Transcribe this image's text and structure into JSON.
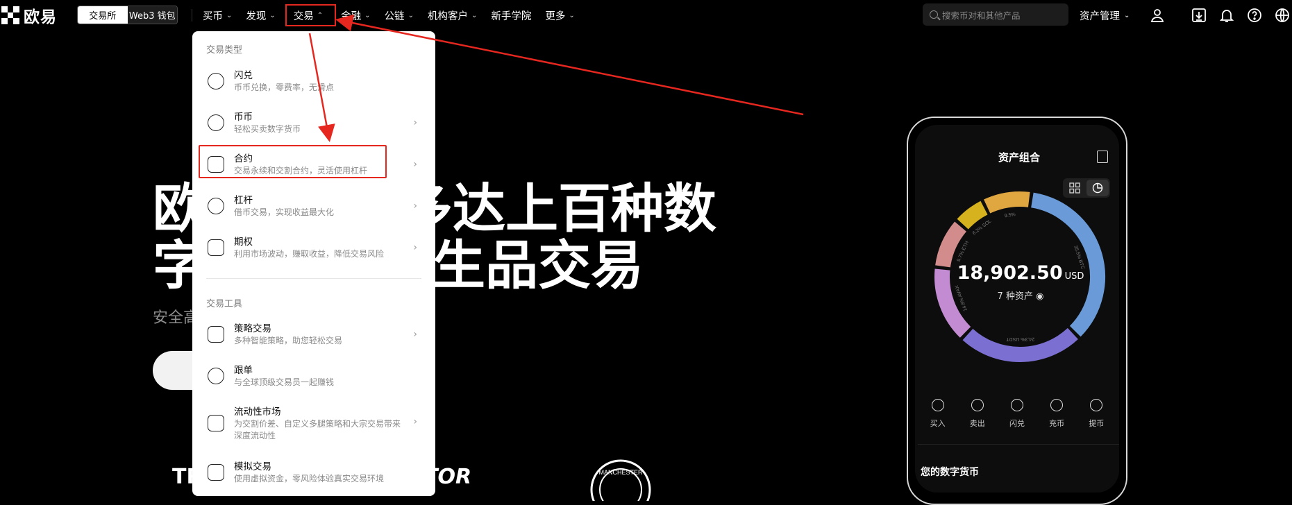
{
  "brand": {
    "name": "欧易"
  },
  "mode_switch": {
    "exchange": "交易所",
    "wallet": "Web3 钱包"
  },
  "nav": {
    "items": [
      {
        "label": "买币",
        "has_chevron": true
      },
      {
        "label": "发现",
        "has_chevron": true
      },
      {
        "label": "交易",
        "has_chevron": true,
        "expanded": true
      },
      {
        "label": "金融",
        "has_chevron": true
      },
      {
        "label": "公链",
        "has_chevron": true
      },
      {
        "label": "机构客户",
        "has_chevron": true
      },
      {
        "label": "新手学院",
        "has_chevron": false
      },
      {
        "label": "更多",
        "has_chevron": true
      }
    ],
    "search_placeholder": "搜索币对和其他产品",
    "asset_management": "资产管理",
    "icons": [
      "user-icon",
      "download-icon",
      "bell-icon",
      "help-icon",
      "globe-icon"
    ]
  },
  "hero": {
    "line1_left": "欧",
    "line1_right": "多达上百种数",
    "line2_left": "字",
    "line2_right": "生品交易",
    "subtitle_fragment": "安全高"
  },
  "dropdown": {
    "section1_title": "交易类型",
    "section1": [
      {
        "title": "闪兑",
        "desc": "币币兑换，零费率，无滑点",
        "icon": "flash-swap-icon",
        "arrow": false
      },
      {
        "title": "币币",
        "desc": "轻松买卖数字货币",
        "icon": "spot-icon",
        "arrow": true
      },
      {
        "title": "合约",
        "desc": "交易永续和交割合约，灵活使用杠杆",
        "icon": "contract-icon",
        "arrow": true,
        "highlighted": true
      },
      {
        "title": "杠杆",
        "desc": "借币交易，实现收益最大化",
        "icon": "margin-icon",
        "arrow": true
      },
      {
        "title": "期权",
        "desc": "利用市场波动，赚取收益，降低交易风险",
        "icon": "options-icon",
        "arrow": true
      }
    ],
    "section2_title": "交易工具",
    "section2": [
      {
        "title": "策略交易",
        "desc": "多种智能策略，助您轻松交易",
        "icon": "bot-icon",
        "arrow": true
      },
      {
        "title": "跟单",
        "desc": "与全球顶级交易员一起赚钱",
        "icon": "copy-trade-icon",
        "arrow": false
      },
      {
        "title": "流动性市场",
        "desc": "为交割价差、自定义多腿策略和大宗交易带来深度流动性",
        "icon": "liquidity-icon",
        "arrow": true
      },
      {
        "title": "模拟交易",
        "desc": "使用虚拟资金，零风险体验真实交易环境",
        "icon": "demo-icon",
        "arrow": false
      }
    ]
  },
  "phone": {
    "title": "资产组合",
    "amount": "18,902.50",
    "unit": "USD",
    "asset_count": "7 种资产",
    "segments": [
      {
        "label": "35.5% BTC",
        "pct": 35.5,
        "color": "#6a9bd8"
      },
      {
        "label": "24.3% USDT",
        "pct": 24.3,
        "color": "#7b6fd1"
      },
      {
        "label": "14.8% AVAX",
        "pct": 14.8,
        "color": "#c38bd2"
      },
      {
        "label": "9.7% ETH",
        "pct": 9.7,
        "color": "#d28c8c"
      },
      {
        "label": "6.2% SOL",
        "pct": 6.2,
        "color": "#d6b21f"
      },
      {
        "label": "9.5%",
        "pct": 9.5,
        "color": "#e0a640"
      }
    ],
    "actions": [
      "买入",
      "卖出",
      "闪兑",
      "充币",
      "提币"
    ],
    "my_coins": "您的数字货币"
  },
  "partners": [
    "TR",
    "TOR",
    "MANCHESTER"
  ]
}
